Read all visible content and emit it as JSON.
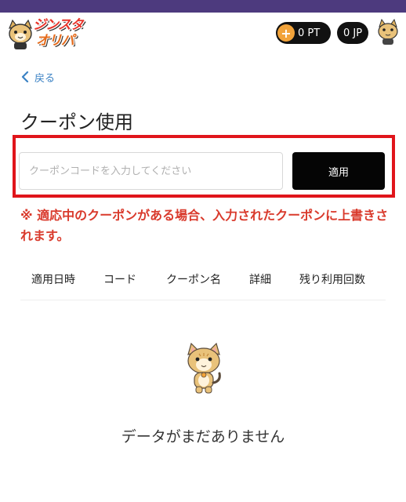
{
  "header": {
    "logo_line1": "ジンスタ",
    "logo_line2": "オリパ",
    "points": "0 PT",
    "coin_symbol": "+",
    "jp": "0 JP"
  },
  "back_label": "戻る",
  "page_title": "クーポン使用",
  "coupon_form": {
    "placeholder": "クーポンコードを入力してください",
    "apply_label": "適用"
  },
  "notice": "※ 適応中のクーポンがある場合、入力されたクーポンに上書きされます。",
  "table": {
    "columns": [
      "適用日時",
      "コード",
      "クーポン名",
      "詳細",
      "残り利用回数"
    ]
  },
  "empty_message": "データがまだありません",
  "colors": {
    "topbar": "#4d3a7e",
    "link": "#3b82c4",
    "notice": "#d93a2c",
    "highlight": "#e0151b",
    "button": "#050505"
  },
  "icons": {
    "back": "chevron-left-icon",
    "coin": "plus-coin-icon",
    "mascot": "cat-mascot-icon"
  }
}
